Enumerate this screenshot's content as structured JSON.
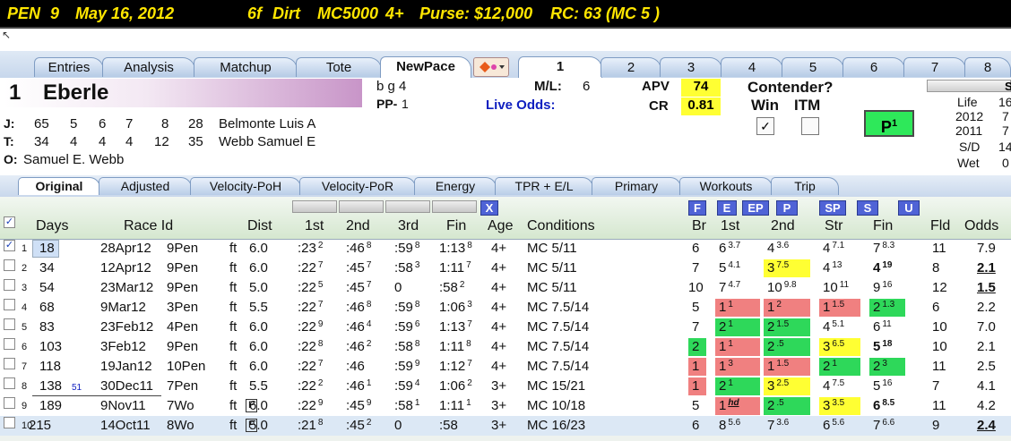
{
  "race_header": {
    "track": "PEN",
    "race_num": "9",
    "date": "May 16, 2012",
    "distance": "6f",
    "surface": "Dirt",
    "class": "MC5000",
    "age": "4+",
    "purse": "Purse: $12,000",
    "rc": "RC: 63  (MC 5 )"
  },
  "main_tabs": [
    "Entries",
    "Analysis",
    "Matchup",
    "Tote",
    "NewPace"
  ],
  "horse_tabs": [
    "1",
    "2",
    "3",
    "4",
    "5",
    "6",
    "7",
    "8"
  ],
  "horse": {
    "num": "1",
    "name": "Eberle",
    "desc": "b g 4",
    "pp_label": "PP-",
    "pp": "1",
    "ml_label": "M/L:",
    "ml": "6",
    "live_odds_label": "Live Odds:",
    "apv_label": "APV",
    "apv": "74",
    "cr_label": "CR",
    "cr": "0.81",
    "contender_label": "Contender?",
    "win_label": "Win",
    "itm_label": "ITM",
    "win_check": "✓",
    "itm_check": "",
    "p_label": "P",
    "p_sup": "1"
  },
  "connections": {
    "jockey": {
      "label": "J:",
      "stats": [
        "65",
        "5",
        "6",
        "7",
        "8",
        "28"
      ],
      "name": "Belmonte Luis A"
    },
    "trainer": {
      "label": "T:",
      "stats": [
        "34",
        "4",
        "4",
        "4",
        "12",
        "35"
      ],
      "name": "Webb Samuel E"
    },
    "owner": {
      "label": "O:",
      "name": "Samuel E. Webb"
    }
  },
  "stats_panel": {
    "head": "S",
    "rows": [
      {
        "label": "Life",
        "val": "16"
      },
      {
        "label": "2012",
        "val": "7"
      },
      {
        "label": "2011",
        "val": "7"
      },
      {
        "label": "S/D",
        "val": "14"
      },
      {
        "label": "Wet",
        "val": "0"
      }
    ]
  },
  "sub_tabs": [
    "Original",
    "Adjusted",
    "Velocity-PoH",
    "Velocity-PoR",
    "Energy",
    "TPR + E/L",
    "Primary",
    "Workouts",
    "Trip"
  ],
  "col_buttons": [
    "F",
    "E",
    "EP",
    "P",
    "SP",
    "S",
    "U"
  ],
  "x_button": "X",
  "headers": {
    "days": "Days",
    "race_id": "Race Id",
    "dist": "Dist",
    "first": "1st",
    "second": "2nd",
    "third": "3rd",
    "fin": "Fin",
    "age": "Age",
    "conditions": "Conditions",
    "br": "Br",
    "c1st": "1st",
    "c2nd": "2nd",
    "str": "Str",
    "cfin": "Fin",
    "fld": "Fld",
    "odds": "Odds"
  },
  "header_check": "✓",
  "rows": [
    {
      "n": "1",
      "checked": "✓",
      "days": "18",
      "days_extra": "",
      "date": "28Apr12",
      "race": "9Pen",
      "surf": "ft",
      "dist": "6.0",
      "pbox": "",
      "f1": ":23",
      "f1s": "2",
      "f2": ":46",
      "f2s": "8",
      "f3": ":59",
      "f3s": "8",
      "fin": "1:13",
      "fins": "8",
      "age": "4+",
      "cond": "MC 5/11",
      "br": "6",
      "br_c": "",
      "p1": "6",
      "p1s": "3.7",
      "p1_c": "",
      "p2": "4",
      "p2s": "3.6",
      "p2_c": "",
      "ps": "4",
      "pss": "7.1",
      "ps_c": "",
      "pf": "7",
      "pfs": "8.3",
      "pf_c": "",
      "pf_b": false,
      "fld": "11",
      "odds": "7.9",
      "odds_u": false
    },
    {
      "n": "2",
      "checked": "",
      "days": "34",
      "days_extra": "",
      "date": "12Apr12",
      "race": "9Pen",
      "surf": "ft",
      "dist": "6.0",
      "pbox": "",
      "f1": ":22",
      "f1s": "7",
      "f2": ":45",
      "f2s": "7",
      "f3": ":58",
      "f3s": "3",
      "fin": "1:11",
      "fins": "7",
      "age": "4+",
      "cond": "MC 5/11",
      "br": "7",
      "br_c": "",
      "p1": "5",
      "p1s": "4.1",
      "p1_c": "",
      "p2": "3",
      "p2s": "7.5",
      "p2_c": "yel",
      "ps": "4",
      "pss": "13",
      "ps_c": "",
      "pf": "4",
      "pfs": "19",
      "pf_c": "",
      "pf_b": true,
      "fld": "8",
      "odds": "2.1",
      "odds_u": true
    },
    {
      "n": "3",
      "checked": "",
      "days": "54",
      "days_extra": "",
      "date": "23Mar12",
      "race": "9Pen",
      "surf": "ft",
      "dist": "5.0",
      "pbox": "",
      "f1": ":22",
      "f1s": "5",
      "f2": ":45",
      "f2s": "7",
      "f3": "0",
      "f3s": "",
      "fin": ":58",
      "fins": "2",
      "age": "4+",
      "cond": "MC 5/11",
      "br": "10",
      "br_c": "",
      "p1": "7",
      "p1s": "4.7",
      "p1_c": "",
      "p2": "10",
      "p2s": "9.8",
      "p2_c": "",
      "ps": "10",
      "pss": "11",
      "ps_c": "",
      "pf": "9",
      "pfs": "16",
      "pf_c": "",
      "pf_b": false,
      "fld": "12",
      "odds": "1.5",
      "odds_u": true
    },
    {
      "n": "4",
      "checked": "",
      "days": "68",
      "days_extra": "",
      "date": "9Mar12",
      "race": "3Pen",
      "surf": "ft",
      "dist": "5.5",
      "pbox": "",
      "f1": ":22",
      "f1s": "7",
      "f2": ":46",
      "f2s": "8",
      "f3": ":59",
      "f3s": "8",
      "fin": "1:06",
      "fins": "3",
      "age": "4+",
      "cond": "MC 7.5/14",
      "br": "5",
      "br_c": "",
      "p1": "1",
      "p1s": "1",
      "p1_c": "red",
      "p2": "1",
      "p2s": "2",
      "p2_c": "red",
      "ps": "1",
      "pss": "1.5",
      "ps_c": "red",
      "pf": "2",
      "pfs": "1.3",
      "pf_c": "grn",
      "pf_b": false,
      "fld": "6",
      "odds": "2.2",
      "odds_u": false
    },
    {
      "n": "5",
      "checked": "",
      "days": "83",
      "days_extra": "",
      "date": "23Feb12",
      "race": "4Pen",
      "surf": "ft",
      "dist": "6.0",
      "pbox": "",
      "f1": ":22",
      "f1s": "9",
      "f2": ":46",
      "f2s": "4",
      "f3": ":59",
      "f3s": "6",
      "fin": "1:13",
      "fins": "7",
      "age": "4+",
      "cond": "MC 7.5/14",
      "br": "7",
      "br_c": "",
      "p1": "2",
      "p1s": "1",
      "p1_c": "grn",
      "p2": "2",
      "p2s": "1.5",
      "p2_c": "grn",
      "ps": "4",
      "pss": "5.1",
      "ps_c": "",
      "pf": "6",
      "pfs": "11",
      "pf_c": "",
      "pf_b": false,
      "fld": "10",
      "odds": "7.0",
      "odds_u": false
    },
    {
      "n": "6",
      "checked": "",
      "days": "103",
      "days_extra": "",
      "date": "3Feb12",
      "race": "9Pen",
      "surf": "ft",
      "dist": "6.0",
      "pbox": "",
      "f1": ":22",
      "f1s": "8",
      "f2": ":46",
      "f2s": "2",
      "f3": ":58",
      "f3s": "8",
      "fin": "1:11",
      "fins": "8",
      "age": "4+",
      "cond": "MC 7.5/14",
      "br": "2",
      "br_c": "grn",
      "p1": "1",
      "p1s": "1",
      "p1_c": "red",
      "p2": "2",
      "p2s": ".5",
      "p2_c": "grn",
      "ps": "3",
      "pss": "6.5",
      "ps_c": "yel",
      "pf": "5",
      "pfs": "18",
      "pf_c": "",
      "pf_b": true,
      "fld": "10",
      "odds": "2.1",
      "odds_u": false
    },
    {
      "n": "7",
      "checked": "",
      "days": "118",
      "days_extra": "",
      "date": "19Jan12",
      "race": "10Pen",
      "surf": "ft",
      "dist": "6.0",
      "pbox": "",
      "f1": ":22",
      "f1s": "7",
      "f2": ":46",
      "f2s": "",
      "f3": ":59",
      "f3s": "9",
      "fin": "1:12",
      "fins": "7",
      "age": "4+",
      "cond": "MC 7.5/14",
      "br": "1",
      "br_c": "red",
      "p1": "1",
      "p1s": "3",
      "p1_c": "red",
      "p2": "1",
      "p2s": "1.5",
      "p2_c": "red",
      "ps": "2",
      "pss": "1",
      "ps_c": "grn",
      "pf": "2",
      "pfs": "3",
      "pf_c": "grn",
      "pf_b": false,
      "fld": "11",
      "odds": "2.5",
      "odds_u": false
    },
    {
      "n": "8",
      "checked": "",
      "days": "138",
      "days_extra": "51",
      "date": "30Dec11",
      "race": "7Pen",
      "surf": "ft",
      "dist": "5.5",
      "pbox": "",
      "f1": ":22",
      "f1s": "2",
      "f2": ":46",
      "f2s": "1",
      "f3": ":59",
      "f3s": "4",
      "fin": "1:06",
      "fins": "2",
      "age": "3+",
      "cond": "MC 15/21",
      "br": "1",
      "br_c": "red",
      "p1": "2",
      "p1s": "1",
      "p1_c": "grn",
      "p2": "3",
      "p2s": "2.5",
      "p2_c": "yel",
      "ps": "4",
      "pss": "7.5",
      "ps_c": "",
      "pf": "5",
      "pfs": "16",
      "pf_c": "",
      "pf_b": false,
      "fld": "7",
      "odds": "4.1",
      "odds_u": false
    },
    {
      "n": "9",
      "checked": "",
      "days": "189",
      "days_extra": "",
      "date": "9Nov11",
      "race": "7Wo",
      "surf": "ft",
      "dist": "6.0",
      "pbox": "P",
      "f1": ":22",
      "f1s": "9",
      "f2": ":45",
      "f2s": "9",
      "f3": ":58",
      "f3s": "1",
      "fin": "1:11",
      "fins": "1",
      "age": "3+",
      "cond": "MC 10/18",
      "br": "5",
      "br_c": "",
      "p1": "1",
      "p1s": "hd",
      "p1_c": "red",
      "p2": "2",
      "p2s": ".5",
      "p2_c": "grn",
      "ps": "3",
      "pss": "3.5",
      "ps_c": "yel",
      "pf": "6",
      "pfs": "8.5",
      "pf_c": "",
      "pf_b": true,
      "fld": "11",
      "odds": "4.2",
      "odds_u": false
    },
    {
      "n": "10",
      "checked": "",
      "days": "215",
      "days_extra": "",
      "date": "14Oct11",
      "race": "8Wo",
      "surf": "ft",
      "dist": "5.0",
      "pbox": "P",
      "f1": ":21",
      "f1s": "8",
      "f2": ":45",
      "f2s": "2",
      "f3": "0",
      "f3s": "",
      "fin": ":58",
      "fins": "",
      "age": "3+",
      "cond": "MC 16/23",
      "br": "6",
      "br_c": "",
      "p1": "8",
      "p1s": "5.6",
      "p1_c": "",
      "p2": "7",
      "p2s": "3.6",
      "p2_c": "",
      "ps": "6",
      "pss": "5.6",
      "ps_c": "",
      "pf": "7",
      "pfs": "6.6",
      "pf_c": "",
      "pf_b": false,
      "fld": "9",
      "odds": "2.4",
      "odds_u": true
    }
  ]
}
